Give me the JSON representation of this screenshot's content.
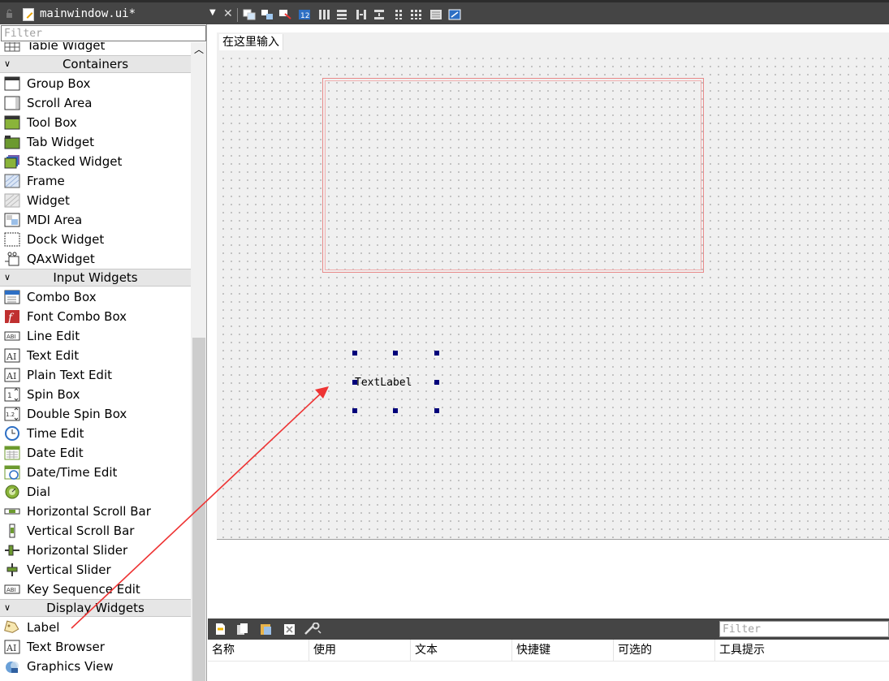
{
  "topbar": {
    "filename": "mainwindow.ui*",
    "dropdown_glyph": "▼",
    "close_glyph": "✕"
  },
  "widget_box": {
    "filter_placeholder": "Filter",
    "items": [
      {
        "type": "item",
        "label": "Table Widget",
        "icon": "table-widget-icon"
      },
      {
        "type": "category",
        "label": "Containers"
      },
      {
        "type": "item",
        "label": "Group Box",
        "icon": "group-box-icon"
      },
      {
        "type": "item",
        "label": "Scroll Area",
        "icon": "scroll-area-icon"
      },
      {
        "type": "item",
        "label": "Tool Box",
        "icon": "tool-box-icon"
      },
      {
        "type": "item",
        "label": "Tab Widget",
        "icon": "tab-widget-icon"
      },
      {
        "type": "item",
        "label": "Stacked Widget",
        "icon": "stacked-widget-icon"
      },
      {
        "type": "item",
        "label": "Frame",
        "icon": "frame-icon"
      },
      {
        "type": "item",
        "label": "Widget",
        "icon": "widget-icon"
      },
      {
        "type": "item",
        "label": "MDI Area",
        "icon": "mdi-area-icon"
      },
      {
        "type": "item",
        "label": "Dock Widget",
        "icon": "dock-widget-icon"
      },
      {
        "type": "item",
        "label": "QAxWidget",
        "icon": "qaxwidget-icon"
      },
      {
        "type": "category",
        "label": "Input Widgets"
      },
      {
        "type": "item",
        "label": "Combo Box",
        "icon": "combo-box-icon"
      },
      {
        "type": "item",
        "label": "Font Combo Box",
        "icon": "font-combo-box-icon"
      },
      {
        "type": "item",
        "label": "Line Edit",
        "icon": "line-edit-icon"
      },
      {
        "type": "item",
        "label": "Text Edit",
        "icon": "text-edit-icon"
      },
      {
        "type": "item",
        "label": "Plain Text Edit",
        "icon": "plain-text-edit-icon"
      },
      {
        "type": "item",
        "label": "Spin Box",
        "icon": "spin-box-icon"
      },
      {
        "type": "item",
        "label": "Double Spin Box",
        "icon": "double-spin-box-icon"
      },
      {
        "type": "item",
        "label": "Time Edit",
        "icon": "time-edit-icon"
      },
      {
        "type": "item",
        "label": "Date Edit",
        "icon": "date-edit-icon"
      },
      {
        "type": "item",
        "label": "Date/Time Edit",
        "icon": "date-time-edit-icon"
      },
      {
        "type": "item",
        "label": "Dial",
        "icon": "dial-icon"
      },
      {
        "type": "item",
        "label": "Horizontal Scroll Bar",
        "icon": "horizontal-scroll-bar-icon"
      },
      {
        "type": "item",
        "label": "Vertical Scroll Bar",
        "icon": "vertical-scroll-bar-icon"
      },
      {
        "type": "item",
        "label": "Horizontal Slider",
        "icon": "horizontal-slider-icon"
      },
      {
        "type": "item",
        "label": "Vertical Slider",
        "icon": "vertical-slider-icon"
      },
      {
        "type": "item",
        "label": "Key Sequence Edit",
        "icon": "key-sequence-edit-icon"
      },
      {
        "type": "category",
        "label": "Display Widgets"
      },
      {
        "type": "item",
        "label": "Label",
        "icon": "label-icon"
      },
      {
        "type": "item",
        "label": "Text Browser",
        "icon": "text-browser-icon"
      },
      {
        "type": "item",
        "label": "Graphics View",
        "icon": "graphics-view-icon"
      }
    ]
  },
  "form": {
    "menu_placeholder": "在这里输入",
    "text_label": "TextLabel"
  },
  "action_editor": {
    "filter_placeholder": "Filter",
    "columns": [
      "名称",
      "使用",
      "文本",
      "快捷键",
      "可选的",
      "工具提示"
    ]
  },
  "colors": {
    "dark_bar": "#454545",
    "canvas_bg": "#f0f0f0",
    "frame_border": "#e88a8a",
    "arrow": "#ee3333",
    "handle": "#00007a"
  }
}
